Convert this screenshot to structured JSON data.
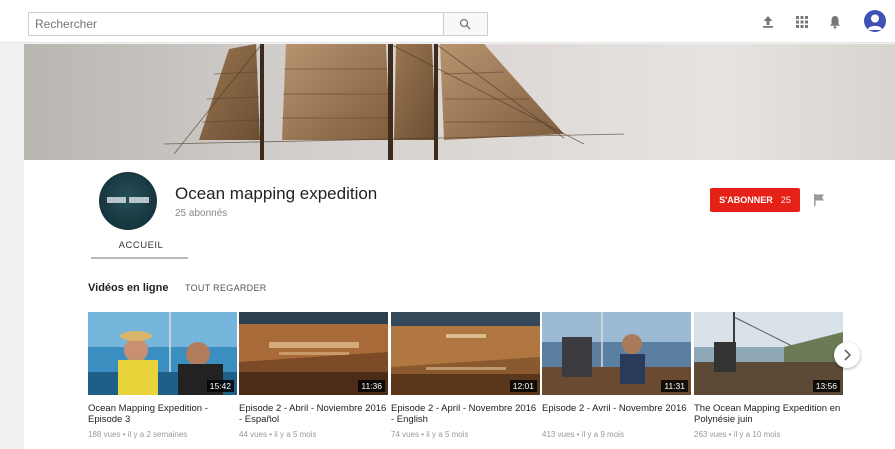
{
  "search": {
    "placeholder": "Rechercher"
  },
  "header_icons": [
    "upload-icon",
    "apps-grid-icon",
    "notifications-bell-icon",
    "account-avatar-icon"
  ],
  "channel": {
    "name": "Ocean mapping expedition",
    "subscribers": "25 abonnés",
    "subscribe_label": "S'ABONNER",
    "subscribe_count": "25"
  },
  "tabs": [
    {
      "label": "ACCUEIL"
    }
  ],
  "section": {
    "title": "Vidéos en ligne",
    "link": "TOUT REGARDER"
  },
  "videos": [
    {
      "title": "Ocean Mapping Expedition - Episode 3",
      "meta": "188 vues • il y a 2 semaines",
      "duration": "15:42"
    },
    {
      "title": "Episode 2 - Abril - Noviembre 2016 - Español",
      "meta": "44 vues • il y a 5 mois",
      "duration": "11:36"
    },
    {
      "title": "Episode 2 - April - Novembre 2016 - English",
      "meta": "74 vues • il y a 5 mois",
      "duration": "12:01"
    },
    {
      "title": "Episode 2 - Avril - Novembre 2016",
      "meta": "413 vues • il y a 9 mois",
      "duration": "11:31"
    },
    {
      "title": "The Ocean Mapping Expedition en Polynésie juin",
      "meta": "263 vues • il y a 10 mois",
      "duration": "13:56"
    }
  ],
  "colors": {
    "accent": "#e62117",
    "background": "#f1f1f1",
    "avatar": "#3f51b5"
  }
}
